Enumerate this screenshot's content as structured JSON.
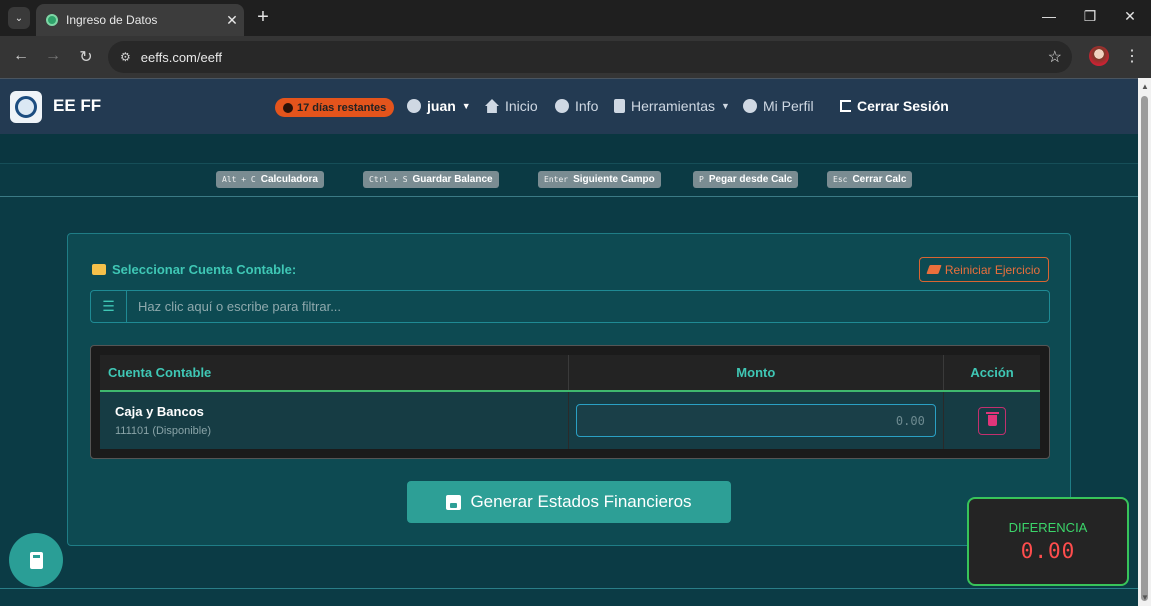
{
  "browser": {
    "tab_title": "Ingreso de Datos",
    "url": "eeffs.com/eeff",
    "close_glyph": "✕",
    "new_tab_glyph": "+",
    "tab_menu_glyph": "⌄",
    "back_glyph": "←",
    "forward_glyph": "→",
    "reload_glyph": "↻",
    "site_info_glyph": "⚙",
    "bookmark_glyph": "☆",
    "menu_glyph": "⋮",
    "minimize_glyph": "—",
    "restore_glyph": "❐",
    "window_close_glyph": "✕"
  },
  "header": {
    "brand": "EE FF",
    "days_badge": "17 días restantes",
    "user": "juan",
    "nav": {
      "inicio": "Inicio",
      "info": "Info",
      "herramientas": "Herramientas",
      "mi_perfil": "Mi Perfil",
      "cerrar_sesion": "Cerrar Sesión"
    },
    "caret": "▼"
  },
  "shortcuts": [
    {
      "key": "Alt + C",
      "label": "Calculadora"
    },
    {
      "key": "Ctrl + S",
      "label": "Guardar Balance"
    },
    {
      "key": "Enter",
      "label": "Siguiente Campo"
    },
    {
      "key": "P",
      "label": "Pegar desde Calc"
    },
    {
      "key": "Esc",
      "label": "Cerrar Calc"
    }
  ],
  "main": {
    "section_title": "Seleccionar Cuenta Contable:",
    "reset_button": "Reiniciar Ejercicio",
    "filter_placeholder": "Haz clic aquí o escribe para filtrar...",
    "list_glyph": "☰",
    "table": {
      "headers": [
        "Cuenta Contable",
        "Monto",
        "Acción"
      ],
      "rows": [
        {
          "name": "Caja y Bancos",
          "code": "111101 (Disponible)",
          "amount_placeholder": "0.00"
        }
      ]
    },
    "generate_button": "Generar Estados Financieros"
  },
  "difference": {
    "label": "DIFERENCIA",
    "value": "0.00"
  },
  "colors": {
    "accent": "#2d9f96",
    "background": "#0b3b45",
    "header": "#233a52",
    "danger": "#ff4d4d",
    "success": "#3bd56a",
    "warning": "#e4541c"
  }
}
